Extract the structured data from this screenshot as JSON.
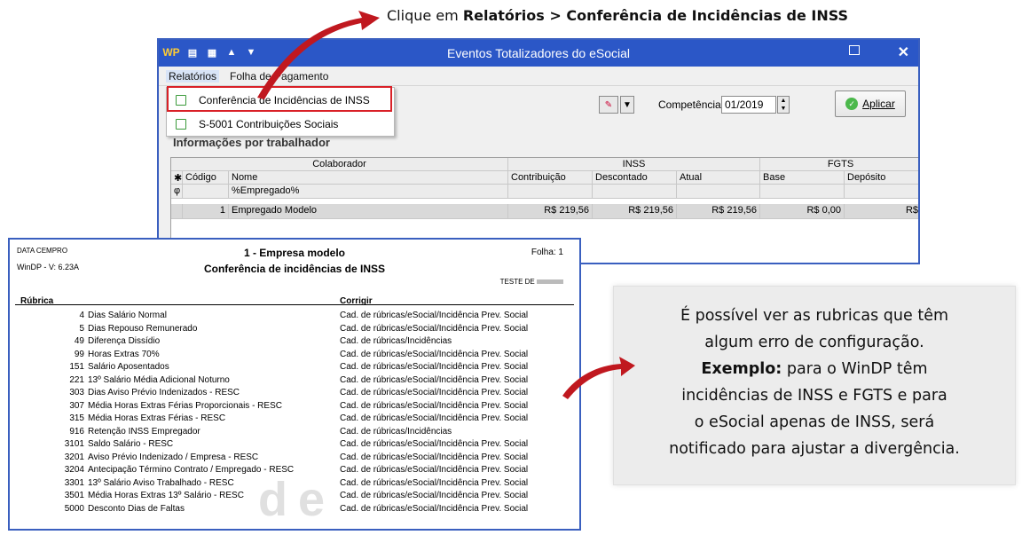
{
  "instruction": {
    "prefix": "Clique em ",
    "bold": "Relatórios > Conferência de Incidências de INSS"
  },
  "window": {
    "title": "Eventos Totalizadores do eSocial",
    "menu": [
      "Relatórios",
      "Folha de Pagamento"
    ],
    "dropdown": [
      "Conferência de Incidências de INSS",
      "S-5001 Contribuições Sociais"
    ],
    "competencia_label": "Competência:",
    "competencia_value": "01/2019",
    "apply_label": "Aplicar",
    "section_title": "Informações por trabalhador",
    "grid": {
      "group_colaborador": "Colaborador",
      "group_inss": "INSS",
      "group_fgts": "FGTS",
      "col_codigo": "Código",
      "col_nome": "Nome",
      "col_contribuicao": "Contribuição",
      "col_descontado": "Descontado",
      "col_atual": "Atual",
      "col_base": "Base",
      "col_deposito": "Depósito",
      "filter_nome": "%Empregado%",
      "row": {
        "codigo": "1",
        "nome": "Empregado Modelo",
        "contribuicao": "R$ 219,56",
        "descontado": "R$ 219,56",
        "atual": "R$ 219,56",
        "base": "R$ 0,00",
        "deposito": "R$"
      }
    }
  },
  "report": {
    "header_left_1": "DATA CEMPRO",
    "header_left_2": "WinDP - V: 6.23A",
    "company": "1 - Empresa modelo",
    "title": "Conferência de incidências de INSS",
    "page": "Folha: 1",
    "user": "TESTE DE",
    "col_rubrica": "Rúbrica",
    "col_corrigir": "Corrigir",
    "watermark": "de",
    "rows": [
      {
        "cod": "4",
        "desc": "Dias Salário Normal",
        "fix": "Cad. de rúbricas/eSocial/Incidência Prev. Social"
      },
      {
        "cod": "5",
        "desc": "Dias Repouso Remunerado",
        "fix": "Cad. de rúbricas/eSocial/Incidência Prev. Social"
      },
      {
        "cod": "49",
        "desc": "Diferença Dissídio",
        "fix": "Cad. de rúbricas/Incidências"
      },
      {
        "cod": "99",
        "desc": "Horas Extras 70%",
        "fix": "Cad. de rúbricas/eSocial/Incidência Prev. Social"
      },
      {
        "cod": "151",
        "desc": "Salário Aposentados",
        "fix": "Cad. de rúbricas/eSocial/Incidência Prev. Social"
      },
      {
        "cod": "221",
        "desc": "13º Salário Média Adicional Noturno",
        "fix": "Cad. de rúbricas/eSocial/Incidência Prev. Social"
      },
      {
        "cod": "303",
        "desc": "Dias Aviso Prévio Indenizados - RESC",
        "fix": "Cad. de rúbricas/eSocial/Incidência Prev. Social"
      },
      {
        "cod": "307",
        "desc": "Média Horas Extras Férias Proporcionais - RESC",
        "fix": "Cad. de rúbricas/eSocial/Incidência Prev. Social"
      },
      {
        "cod": "315",
        "desc": "Média Horas Extras Férias - RESC",
        "fix": "Cad. de rúbricas/eSocial/Incidência Prev. Social"
      },
      {
        "cod": "916",
        "desc": "Retenção INSS Empregador",
        "fix": "Cad. de rúbricas/Incidências"
      },
      {
        "cod": "3101",
        "desc": "Saldo Salário - RESC",
        "fix": "Cad. de rúbricas/eSocial/Incidência Prev. Social"
      },
      {
        "cod": "3201",
        "desc": "Aviso Prévio Indenizado / Empresa - RESC",
        "fix": "Cad. de rúbricas/eSocial/Incidência Prev. Social"
      },
      {
        "cod": "3204",
        "desc": "Antecipação Término Contrato / Empregado - RESC",
        "fix": "Cad. de rúbricas/eSocial/Incidência Prev. Social"
      },
      {
        "cod": "3301",
        "desc": "13º Salário Aviso Trabalhado - RESC",
        "fix": "Cad. de rúbricas/eSocial/Incidência Prev. Social"
      },
      {
        "cod": "3501",
        "desc": "Média Horas Extras 13º Salário - RESC",
        "fix": "Cad. de rúbricas/eSocial/Incidência Prev. Social"
      },
      {
        "cod": "5000",
        "desc": "Desconto Dias de Faltas",
        "fix": "Cad. de rúbricas/eSocial/Incidência Prev. Social"
      }
    ]
  },
  "note": {
    "line1": "É possível ver as rubricas que têm",
    "line2": "algum erro de configuração.",
    "bold": "Exemplo:",
    "line3": " para o WinDP têm",
    "line4": "incidências de INSS e FGTS e para",
    "line5": "o eSocial apenas de INSS, será",
    "line6": "notificado para ajustar a divergência."
  },
  "colors": {
    "titlebar": "#2b57c7",
    "highlight": "#d92027",
    "arrow": "#c0181f",
    "frame": "#3a5fbf"
  }
}
